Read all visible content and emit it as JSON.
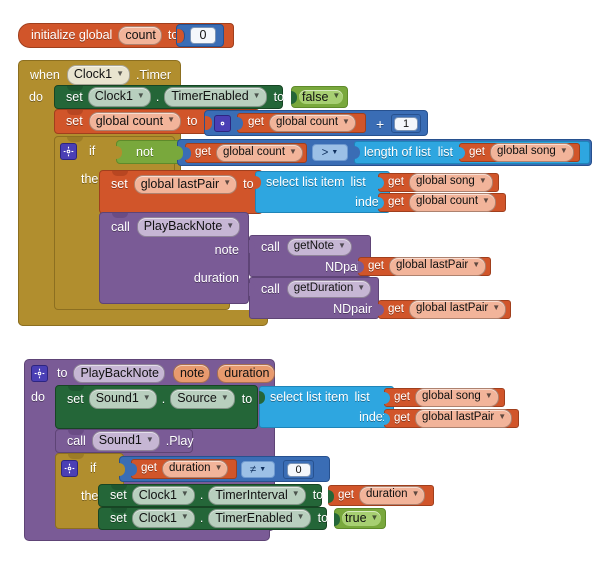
{
  "workspace": {
    "name": "MIT App Inventor Blocks Editor",
    "background": "#ffffff"
  },
  "colors": {
    "variable_orange": "#d1552a",
    "variable_orange_light": "#f2b49a",
    "event_gold": "#b18e2e",
    "component_set_green": "#246638",
    "logic_green": "#79a83c",
    "math_blue": "#3a6db5",
    "control_gold": "#b18e2e",
    "list_blue": "#2ea6e0",
    "procedure_purple": "#7a5b96",
    "text_white": "#ffffff",
    "mutator_purple": "#4a3fb5"
  },
  "blocks": {
    "init_global": {
      "keyword1": "initialize global",
      "name": "count",
      "keyword2": "to",
      "value": "0"
    },
    "when_clock_timer": {
      "when": "when",
      "component": "Clock1",
      "event": ".Timer",
      "do": "do",
      "set_timer_enabled": {
        "set": "set",
        "component": "Clock1",
        "dot": ".",
        "property": "TimerEnabled",
        "to": "to",
        "value": "false"
      },
      "set_global_count": {
        "set": "set",
        "variable": "global count",
        "to": "to",
        "plus_operator": "+",
        "get": "get",
        "get_variable": "global count",
        "addend": "1"
      },
      "if_block": {
        "if": "if",
        "then": "then",
        "not": "not",
        "get": "get",
        "get_variable": "global count",
        "comparison": ">",
        "length_of_list": "length of list",
        "list_label": "list",
        "list_get": "get",
        "list_variable": "global song"
      },
      "set_last_pair": {
        "set": "set",
        "variable": "global lastPair",
        "to": "to",
        "select_list_item": "select list item",
        "list_label": "list",
        "index_label": "index",
        "list_get": "get",
        "list_variable": "global song",
        "index_get": "get",
        "index_variable": "global count"
      },
      "call_playbacknote": {
        "call": "call",
        "procedure": "PlayBackNote",
        "note_label": "note",
        "duration_label": "duration",
        "note_call": {
          "call": "call",
          "procedure": "getNote",
          "arg_label": "NDpair",
          "arg_get": "get",
          "arg_variable": "global lastPair"
        },
        "duration_call": {
          "call": "call",
          "procedure": "getDuration",
          "arg_label": "NDpair",
          "arg_get": "get",
          "arg_variable": "global lastPair"
        }
      }
    },
    "procedure_playbacknote": {
      "to": "to",
      "name": "PlayBackNote",
      "params": [
        "note",
        "duration"
      ],
      "do": "do",
      "set_sound_source": {
        "set": "set",
        "component": "Sound1",
        "dot": ".",
        "property": "Source",
        "to": "to",
        "select_list_item": "select list item",
        "list_label": "list",
        "index_label": "index",
        "list_get": "get",
        "list_variable": "global song",
        "index_get": "get",
        "index_variable": "global lastPair"
      },
      "call_sound_play": {
        "call": "call",
        "component": "Sound1",
        "method": ".Play"
      },
      "if_block": {
        "if": "if",
        "then": "then",
        "get": "get",
        "get_variable": "duration",
        "comparison": "≠",
        "compare_value": "0"
      },
      "set_timer_interval": {
        "set": "set",
        "component": "Clock1",
        "dot": ".",
        "property": "TimerInterval",
        "to": "to",
        "get": "get",
        "get_variable": "duration"
      },
      "set_timer_enabled": {
        "set": "set",
        "component": "Clock1",
        "dot": ".",
        "property": "TimerEnabled",
        "to": "to",
        "value": "true"
      }
    }
  },
  "icons": {
    "mutator": "gear-icon",
    "dropdown": "chevron-down-icon"
  }
}
